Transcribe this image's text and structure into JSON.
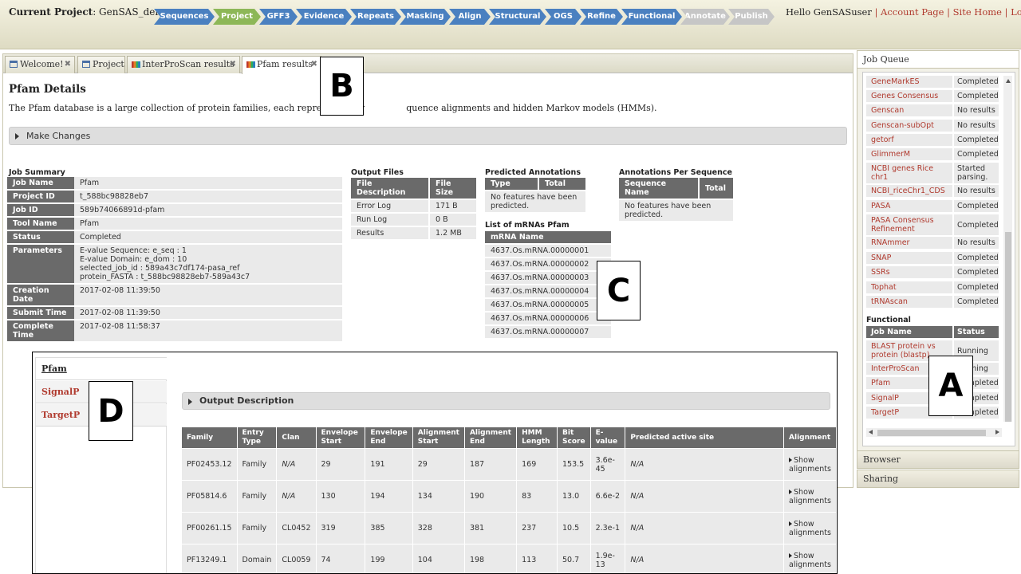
{
  "header": {
    "project_label": "Current Project",
    "project_name": ": GenSAS_demo",
    "greeting": "Hello GenSASuser",
    "separator": "|",
    "links": [
      "Account Page",
      "Site Home",
      "Log out"
    ],
    "steps": [
      {
        "label": "Sequences",
        "state": "blue"
      },
      {
        "label": "Project",
        "state": "green"
      },
      {
        "label": "GFF3",
        "state": "blue"
      },
      {
        "label": "Evidence",
        "state": "blue"
      },
      {
        "label": "Repeats",
        "state": "blue"
      },
      {
        "label": "Masking",
        "state": "blue"
      },
      {
        "label": "Align",
        "state": "blue"
      },
      {
        "label": "Structural",
        "state": "blue"
      },
      {
        "label": "OGS",
        "state": "blue"
      },
      {
        "label": "Refine",
        "state": "blue"
      },
      {
        "label": "Functional",
        "state": "blue"
      },
      {
        "label": "Annotate",
        "state": "gray"
      },
      {
        "label": "Publish",
        "state": "gray"
      }
    ]
  },
  "tabs": [
    {
      "label": "Welcome!",
      "close": "✖"
    },
    {
      "label": "Project",
      "close": "✖"
    },
    {
      "label": "InterProScan results",
      "close": "✖"
    },
    {
      "label": "Pfam results",
      "close": "✖"
    }
  ],
  "details": {
    "title": "Pfam Details",
    "description_start": "The Pfam database is a large collection of protein families, each represented by",
    "description_end": "quence alignments and hidden Markov models (HMMs).",
    "make_changes": "Make Changes"
  },
  "job_summary": {
    "title": "Job Summary",
    "rows": [
      {
        "key": "Job Name",
        "value": "Pfam"
      },
      {
        "key": "Project ID",
        "value": "t_588bc98828eb7"
      },
      {
        "key": "Job ID",
        "value": "589b74066891d-pfam"
      },
      {
        "key": "Tool Name",
        "value": "Pfam"
      },
      {
        "key": "Status",
        "value": "Completed"
      },
      {
        "key": "Parameters",
        "value_lines": [
          "E-value Sequence: e_seq : 1",
          "E-value Domain: e_dom : 10",
          "selected_job_id : 589a43c7df174-pasa_ref",
          "protein_FASTA : t_588bc98828eb7-589a43c7"
        ]
      },
      {
        "key": "Creation Date",
        "value": "2017-02-08 11:39:50"
      },
      {
        "key": "Submit Time",
        "value": "2017-02-08 11:39:50"
      },
      {
        "key": "Complete Time",
        "value": "2017-02-08 11:58:37"
      }
    ]
  },
  "output_files": {
    "title": "Output Files",
    "headers": [
      "File Description",
      "File Size"
    ],
    "rows": [
      [
        "Error Log",
        "171 B"
      ],
      [
        "Run Log",
        "0 B"
      ],
      [
        "Results",
        "1.2 MB"
      ]
    ]
  },
  "predicted_annotations": {
    "title": "Predicted Annotations",
    "headers": [
      "Type",
      "Total"
    ],
    "empty": "No features have been predicted."
  },
  "annotations_per_sequence": {
    "title": "Annotations Per Sequence",
    "headers": [
      "Sequence Name",
      "Total"
    ],
    "empty": "No features have been predicted."
  },
  "mrna_list": {
    "title": "List of mRNAs Pfam",
    "header": "mRNA Name",
    "items": [
      "4637.Os.mRNA.00000001",
      "4637.Os.mRNA.00000002",
      "4637.Os.mRNA.00000003",
      "4637.Os.mRNA.00000004",
      "4637.Os.mRNA.00000005",
      "4637.Os.mRNA.00000006",
      "4637.Os.mRNA.00000007"
    ]
  },
  "markers": {
    "a": "A",
    "b": "B",
    "c": "C",
    "d": "D"
  },
  "job_queue": {
    "title": "Job Queue",
    "rows": [
      {
        "name": "GeneMarkES",
        "status": "Completed"
      },
      {
        "name": "Genes Consensus",
        "status": "Completed"
      },
      {
        "name": "Genscan",
        "status": "No results"
      },
      {
        "name": "Genscan-subOpt",
        "status": "No results"
      },
      {
        "name": "getorf",
        "status": "Completed"
      },
      {
        "name": "GlimmerM",
        "status": "Completed"
      },
      {
        "name": "NCBI genes Rice chr1",
        "status": "Started parsing."
      },
      {
        "name": "NCBI_riceChr1_CDS",
        "status": "No results"
      },
      {
        "name": "PASA",
        "status": "Completed"
      },
      {
        "name": "PASA Consensus Refinement",
        "status": "Completed"
      },
      {
        "name": "RNAmmer",
        "status": "No results"
      },
      {
        "name": "SNAP",
        "status": "Completed"
      },
      {
        "name": "SSRs",
        "status": "Completed"
      },
      {
        "name": "Tophat",
        "status": "Completed"
      },
      {
        "name": "tRNAscan",
        "status": "Completed"
      }
    ],
    "functional_title": "Functional",
    "functional_headers": [
      "Job Name",
      "Status"
    ],
    "functional_rows": [
      {
        "name": "BLAST protein vs protein (blastp)",
        "status": "Running"
      },
      {
        "name": "InterProScan",
        "status": "Running"
      },
      {
        "name": "Pfam",
        "status": "Completed"
      },
      {
        "name": "SignalP",
        "status": "Completed"
      },
      {
        "name": "TargetP",
        "status": "Completed"
      }
    ],
    "browser": "Browser",
    "sharing": "Sharing"
  },
  "inset": {
    "nav": [
      "Pfam",
      "SignalP",
      "TargetP"
    ],
    "output_description": "Output Description",
    "headers": [
      "Family",
      "Entry Type",
      "Clan",
      "Envelope Start",
      "Envelope End",
      "Alignment Start",
      "Alignment End",
      "HMM Length",
      "Bit Score",
      "E-value",
      "Predicted active site",
      "Alignment"
    ],
    "rows": [
      [
        "PF02453.12",
        "Family",
        "N/A",
        "29",
        "191",
        "29",
        "187",
        "169",
        "153.5",
        "3.6e-45",
        "N/A",
        "Show alignments"
      ],
      [
        "PF05814.6",
        "Family",
        "N/A",
        "130",
        "194",
        "134",
        "190",
        "83",
        "13.0",
        "6.6e-2",
        "N/A",
        "Show alignments"
      ],
      [
        "PF00261.15",
        "Family",
        "CL0452",
        "319",
        "385",
        "328",
        "381",
        "237",
        "10.5",
        "2.3e-1",
        "N/A",
        "Show alignments"
      ],
      [
        "PF13249.1",
        "Domain",
        "CL0059",
        "74",
        "199",
        "104",
        "198",
        "113",
        "50.7",
        "1.9e-13",
        "N/A",
        "Show alignments"
      ]
    ]
  },
  "colors": {
    "step_blue": "#4a80c0",
    "step_green": "#8db757",
    "step_gray": "#c6c6c6",
    "link_red": "#b03a2e",
    "header_gray": "#6a6a6a"
  }
}
